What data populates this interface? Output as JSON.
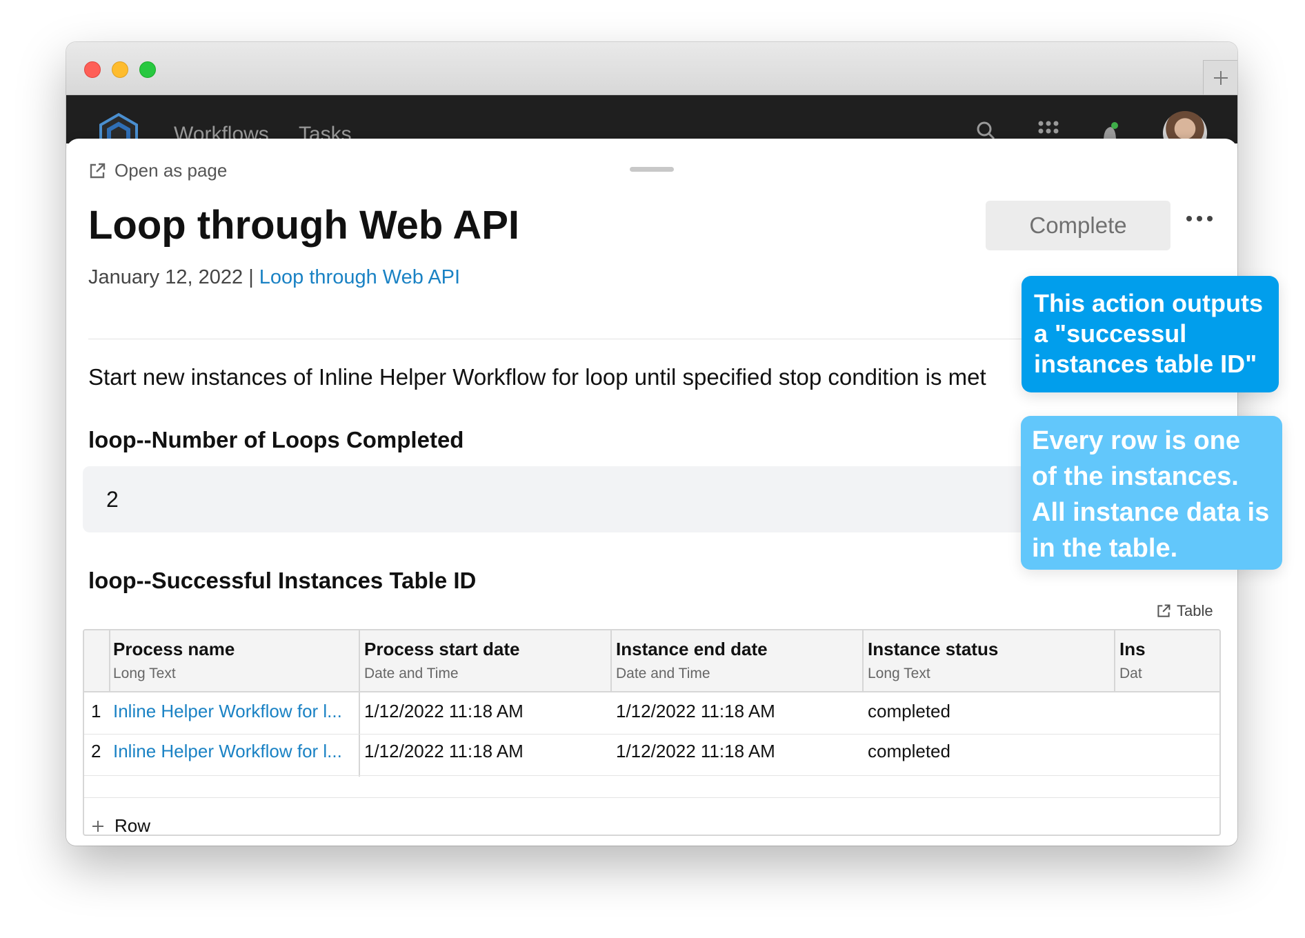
{
  "browser": {
    "new_tab_icon": "plus-icon"
  },
  "appbar": {
    "nav": [
      {
        "label": "Workflows"
      },
      {
        "label": "Tasks"
      }
    ],
    "icons": [
      "search-icon",
      "apps-grid-icon",
      "notification-icon"
    ]
  },
  "panel": {
    "open_as_page": "Open as page",
    "title": "Loop through Web API",
    "complete_label": "Complete",
    "date": "January 12, 2022",
    "separator": "|",
    "workflow_link": "Loop through Web API",
    "description": "Start new instances of Inline Helper Workflow for loop until specified stop condition is met",
    "loops_heading": "loop--Number of Loops Completed",
    "loops_value": "2",
    "table_heading": "loop--Successful Instances Table ID",
    "table_link": "Table",
    "add_row": "Row"
  },
  "table": {
    "columns": [
      {
        "name": "Process name",
        "type": "Long Text"
      },
      {
        "name": "Process start date",
        "type": "Date and Time"
      },
      {
        "name": "Instance end date",
        "type": "Date and Time"
      },
      {
        "name": "Instance status",
        "type": "Long Text"
      },
      {
        "name": "Ins",
        "type": "Dat"
      }
    ],
    "rows": [
      {
        "num": "1",
        "process": "Inline Helper Workflow for l...",
        "start": "1/12/2022 11:18 AM",
        "end": "1/12/2022 11:18 AM",
        "status": "completed"
      },
      {
        "num": "2",
        "process": "Inline Helper Workflow for l...",
        "start": "1/12/2022 11:18 AM",
        "end": "1/12/2022 11:18 AM",
        "status": "completed"
      }
    ]
  },
  "callouts": {
    "first": "This action outputs a \"successul instances table ID\"",
    "second": "Every row is one of the instances. All instance data is in the table."
  }
}
